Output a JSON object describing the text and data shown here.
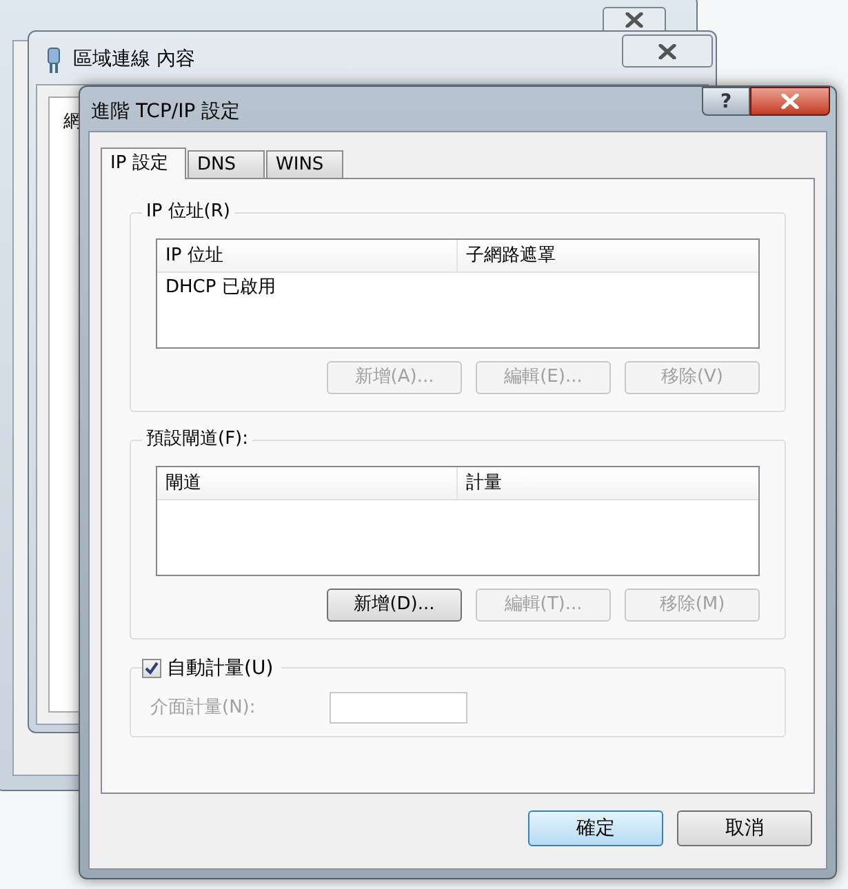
{
  "background_windows": [
    {
      "title": "區域連線 內容",
      "tab_fragment": "網"
    }
  ],
  "dialog": {
    "title": "進階 TCP/IP 設定",
    "help_button": "?",
    "tabs": [
      {
        "label": "IP 設定",
        "selected": true
      },
      {
        "label": "DNS",
        "selected": false
      },
      {
        "label": "WINS",
        "selected": false
      }
    ],
    "ip_group": {
      "legend": "IP 位址(R)",
      "columns": [
        "IP 位址",
        "子網路遮罩"
      ],
      "rows": [
        [
          "DHCP 已啟用"
        ]
      ],
      "buttons": [
        {
          "label": "新增(A)...",
          "disabled": true
        },
        {
          "label": "編輯(E)...",
          "disabled": true
        },
        {
          "label": "移除(V)",
          "disabled": true
        }
      ]
    },
    "gateway_group": {
      "legend": "預設閘道(F):",
      "columns": [
        "閘道",
        "計量"
      ],
      "buttons": [
        {
          "label": "新增(D)...",
          "disabled": false
        },
        {
          "label": "編輯(T)...",
          "disabled": true
        },
        {
          "label": "移除(M)",
          "disabled": true
        }
      ]
    },
    "metric_group": {
      "checkbox": {
        "label": "自動計量(U)",
        "checked": true
      },
      "interface_metric": {
        "label": "介面計量(N):",
        "disabled": true
      }
    },
    "footer_buttons": [
      {
        "label": "確定",
        "default": true
      },
      {
        "label": "取消",
        "default": false
      }
    ]
  }
}
